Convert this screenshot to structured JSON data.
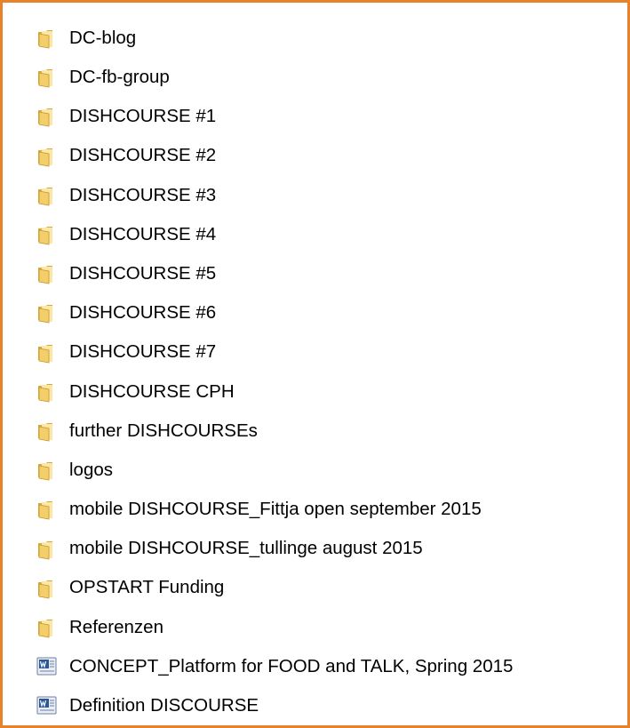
{
  "items": [
    {
      "label": "DC-blog",
      "icon": "folder-icon"
    },
    {
      "label": "DC-fb-group",
      "icon": "folder-icon"
    },
    {
      "label": "DISHCOURSE #1",
      "icon": "folder-icon"
    },
    {
      "label": "DISHCOURSE #2",
      "icon": "folder-icon"
    },
    {
      "label": "DISHCOURSE #3",
      "icon": "folder-icon"
    },
    {
      "label": "DISHCOURSE #4",
      "icon": "folder-icon"
    },
    {
      "label": "DISHCOURSE #5",
      "icon": "folder-icon"
    },
    {
      "label": "DISHCOURSE #6",
      "icon": "folder-icon"
    },
    {
      "label": "DISHCOURSE #7",
      "icon": "folder-icon"
    },
    {
      "label": "DISHCOURSE CPH",
      "icon": "folder-icon"
    },
    {
      "label": "further DISHCOURSEs",
      "icon": "folder-icon"
    },
    {
      "label": "logos",
      "icon": "folder-icon"
    },
    {
      "label": "mobile DISHCOURSE_Fittja open september 2015",
      "icon": "folder-icon"
    },
    {
      "label": "mobile DISHCOURSE_tullinge august 2015",
      "icon": "folder-icon"
    },
    {
      "label": "OPSTART Funding",
      "icon": "folder-icon"
    },
    {
      "label": "Referenzen",
      "icon": "folder-icon"
    },
    {
      "label": "CONCEPT_Platform for FOOD and TALK, Spring 2015",
      "icon": "word-document-icon"
    },
    {
      "label": "Definition DISCOURSE",
      "icon": "word-document-icon"
    }
  ],
  "colors": {
    "frame_border": "#e8822a",
    "folder_front": "#f2cf6a",
    "folder_back": "#d9a83a",
    "word_blue": "#2b5797"
  }
}
